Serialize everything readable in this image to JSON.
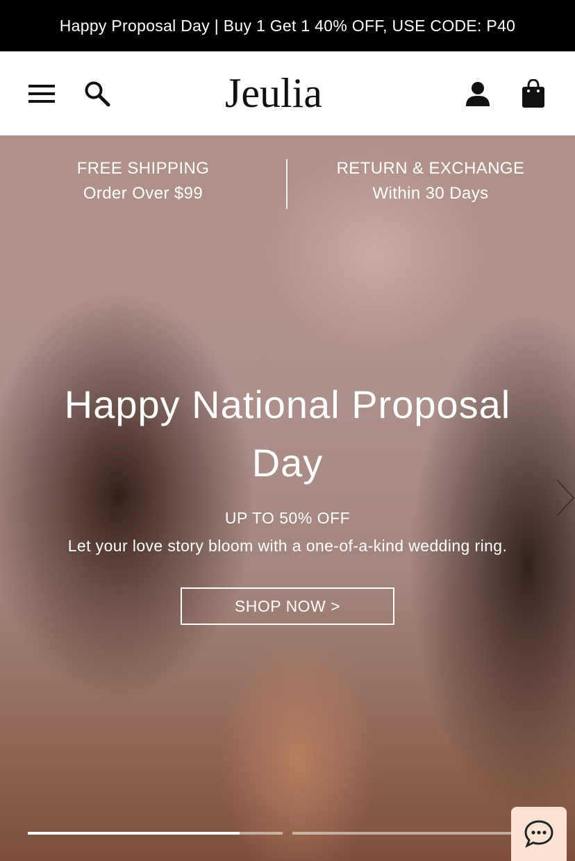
{
  "promo": {
    "text": "Happy Proposal Day | Buy 1 Get 1 40% OFF, USE CODE: P40"
  },
  "header": {
    "logo_text": "Jeulia",
    "icons": {
      "menu": "hamburger-menu-icon",
      "search": "search-icon",
      "account": "user-icon",
      "cart": "shopping-bag-icon"
    }
  },
  "ribbon": {
    "left_title": "FREE SHIPPING",
    "left_sub": "Order Over $99",
    "right_title": "RETURN & EXCHANGE",
    "right_sub": "Within 30 Days"
  },
  "hero": {
    "title": "Happy National Proposal Day",
    "subtitle": "UP TO 50% OFF",
    "description": "Let your love story bloom with a one-of-a-kind wedding ring.",
    "cta_label": "SHOP NOW >",
    "slide_progress": [
      0.83,
      0
    ]
  },
  "chat": {
    "icon": "chat-bubble-icon"
  },
  "colors": {
    "promo_bg": "#000000",
    "chat_bg": "#fbe3d4",
    "text_light": "#ffffff"
  }
}
